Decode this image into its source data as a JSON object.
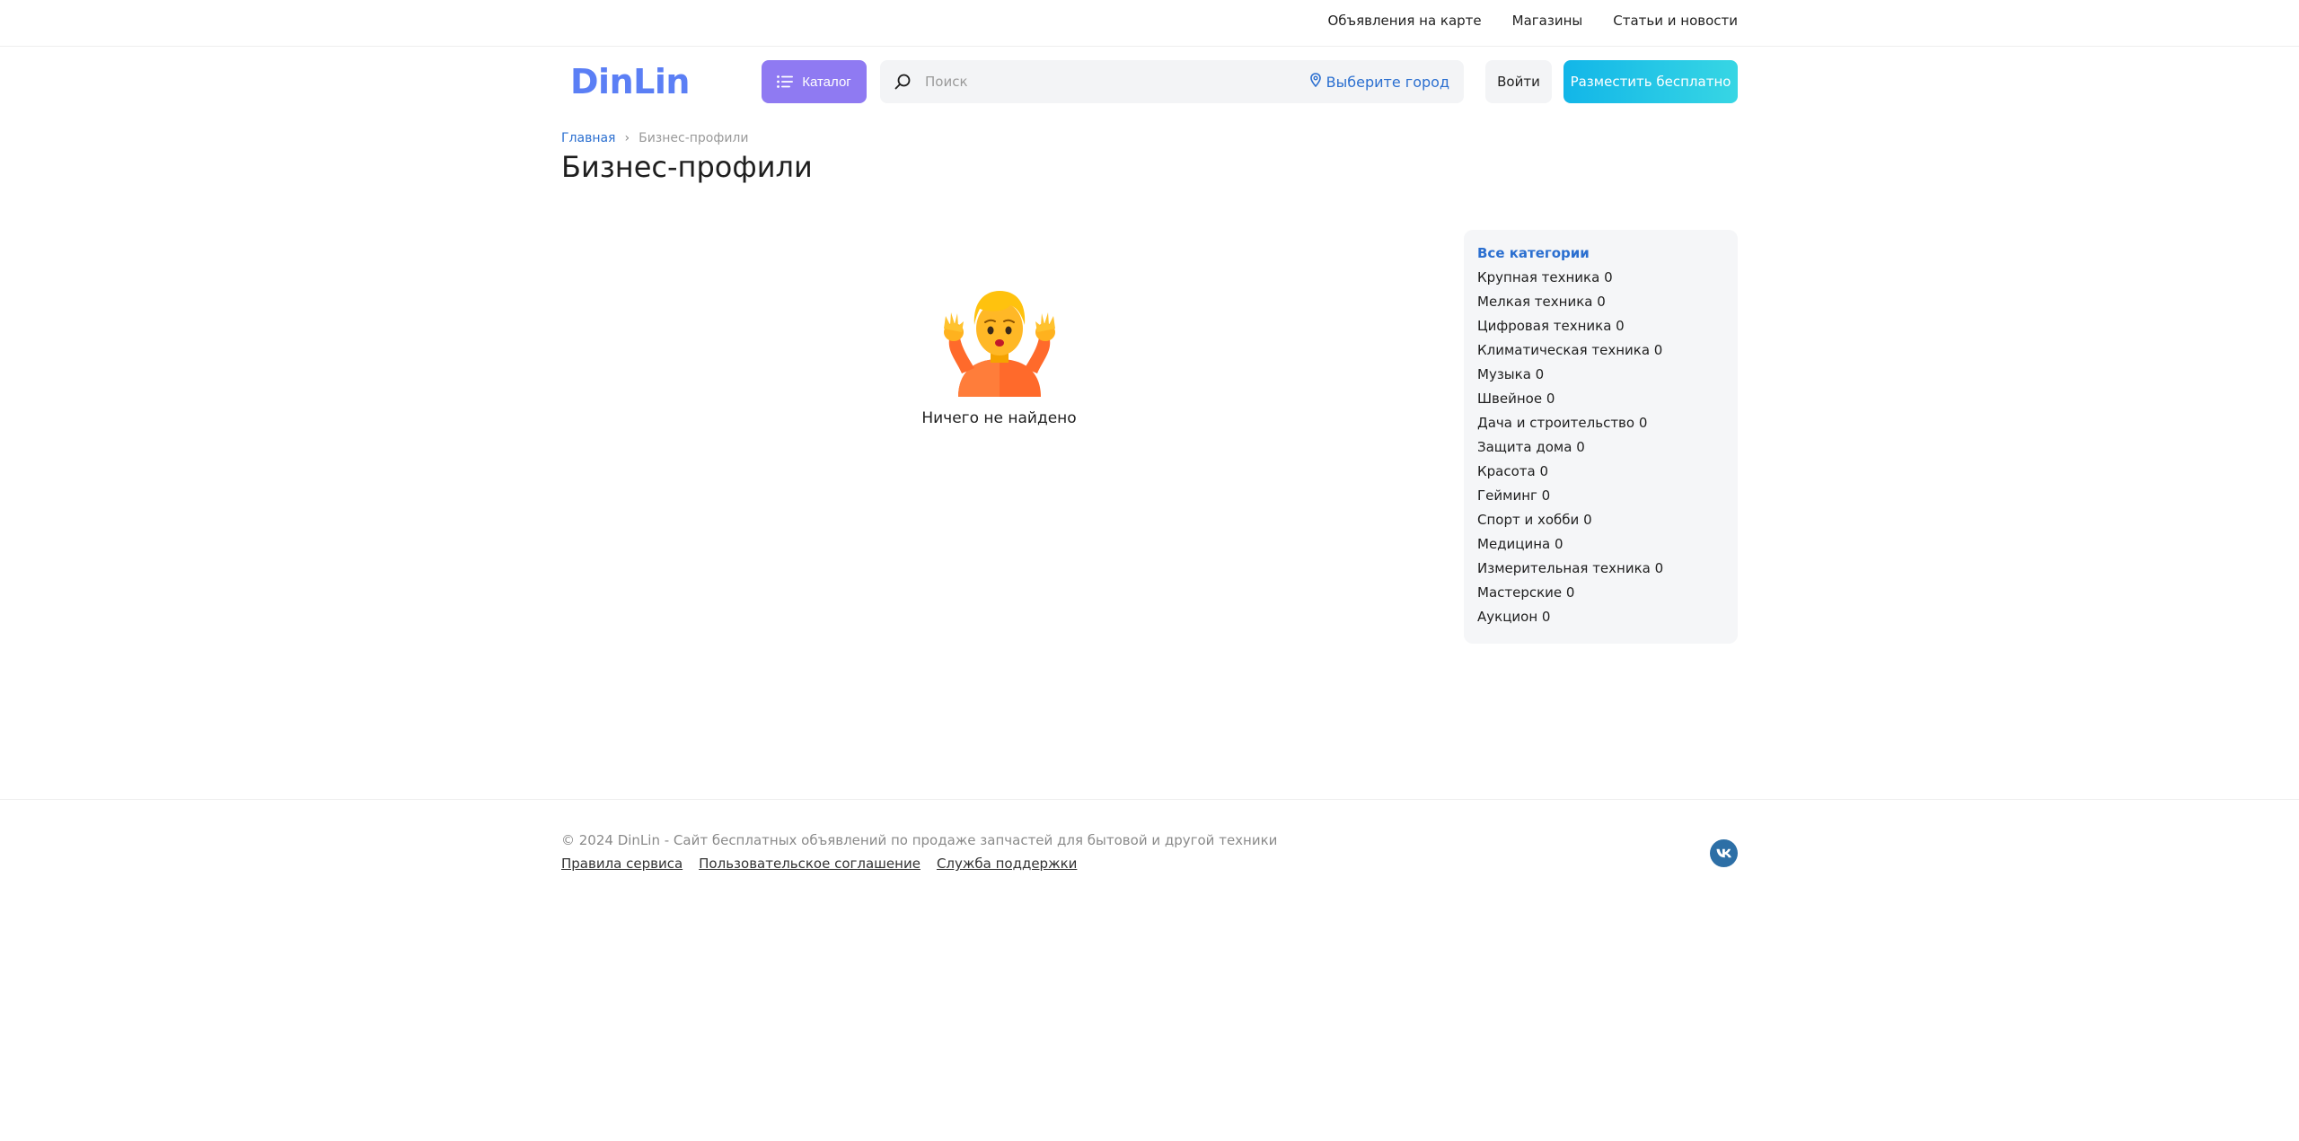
{
  "topbar": {
    "nav": [
      {
        "label": "Объявления на карте"
      },
      {
        "label": "Магазины"
      },
      {
        "label": "Статьи и новости"
      }
    ]
  },
  "header": {
    "logo": "DinLin",
    "catalog_label": "Каталог",
    "search_placeholder": "Поиск",
    "city_label": "Выберите город",
    "login_label": "Войти",
    "post_label": "Разместить бесплатно"
  },
  "breadcrumb": {
    "home": "Главная",
    "separator": "›",
    "current": "Бизнес-профили"
  },
  "page": {
    "title": "Бизнес-профили",
    "empty_text": "Ничего не найдено"
  },
  "categories": {
    "all_label": "Все категории",
    "items": [
      {
        "label": "Крупная техника 0"
      },
      {
        "label": "Мелкая техника 0"
      },
      {
        "label": "Цифровая техника 0"
      },
      {
        "label": "Климатическая техника 0"
      },
      {
        "label": "Музыка 0"
      },
      {
        "label": "Швейное 0"
      },
      {
        "label": "Дача и строительство 0"
      },
      {
        "label": "Защита дома 0"
      },
      {
        "label": "Красота 0"
      },
      {
        "label": "Гейминг 0"
      },
      {
        "label": "Спорт и хобби 0"
      },
      {
        "label": "Медицина 0"
      },
      {
        "label": "Измерительная техника 0"
      },
      {
        "label": "Мастерские 0"
      },
      {
        "label": "Аукцион 0"
      }
    ]
  },
  "footer": {
    "copyright": "© 2024 DinLin - Сайт бесплатных объявлений по продаже запчастей для бытовой и другой техники",
    "links": [
      {
        "label": "Правила сервиса"
      },
      {
        "label": "Пользовательское соглашение"
      },
      {
        "label": "Служба поддержки"
      }
    ],
    "social_icon": "vk-icon"
  },
  "colors": {
    "accent_blue": "#2b6fd0",
    "logo": "#5b7ff5",
    "catalog_button": "#8f7af2",
    "post_button_start": "#12b6e8",
    "post_button_end": "#37d6e4",
    "vk": "#2d6fa6"
  }
}
